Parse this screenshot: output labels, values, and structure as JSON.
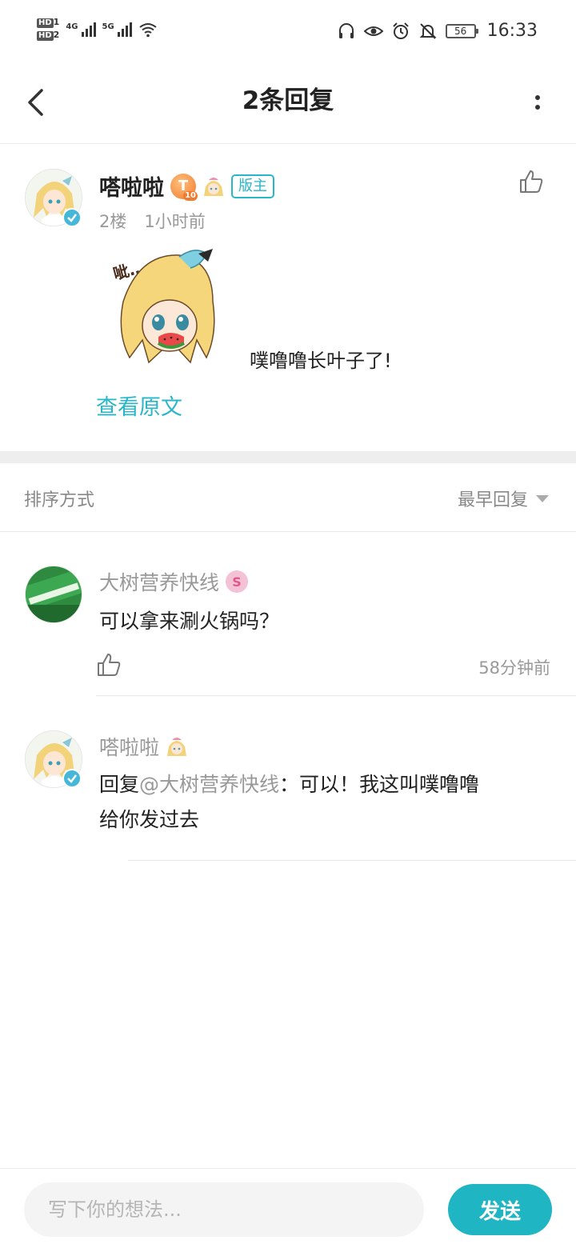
{
  "status_bar": {
    "hd1": "HD",
    "hd1_sub": "1",
    "hd2": "HD",
    "hd2_sub": "2",
    "net1": "4G",
    "net2": "5G",
    "battery": "56",
    "time": "16:33"
  },
  "header": {
    "title": "2条回复"
  },
  "post": {
    "author": "嗒啦啦",
    "level": "T",
    "level_num": "10",
    "role_tag": "版主",
    "floor": "2楼",
    "time": "1小时前",
    "text": "噗噜噜长叶子了!",
    "view_original": "查看原文"
  },
  "sort": {
    "label": "排序方式",
    "selected": "最早回复"
  },
  "replies": [
    {
      "author": "大树营养快线",
      "badge": "S",
      "text": "可以拿来涮火锅吗？",
      "time": "58分钟前"
    },
    {
      "author": "嗒啦啦",
      "reply_prefix": "回复",
      "mention": "@大树营养快线",
      "colon": "：",
      "text_line1": "可以！我这叫噗噜噜",
      "text_line2": "给你发过去"
    }
  ],
  "composer": {
    "placeholder": "写下你的想法...",
    "send_label": "发送"
  },
  "colors": {
    "accent": "#1fb5c3",
    "link": "#29b6c9",
    "muted": "#999999"
  }
}
